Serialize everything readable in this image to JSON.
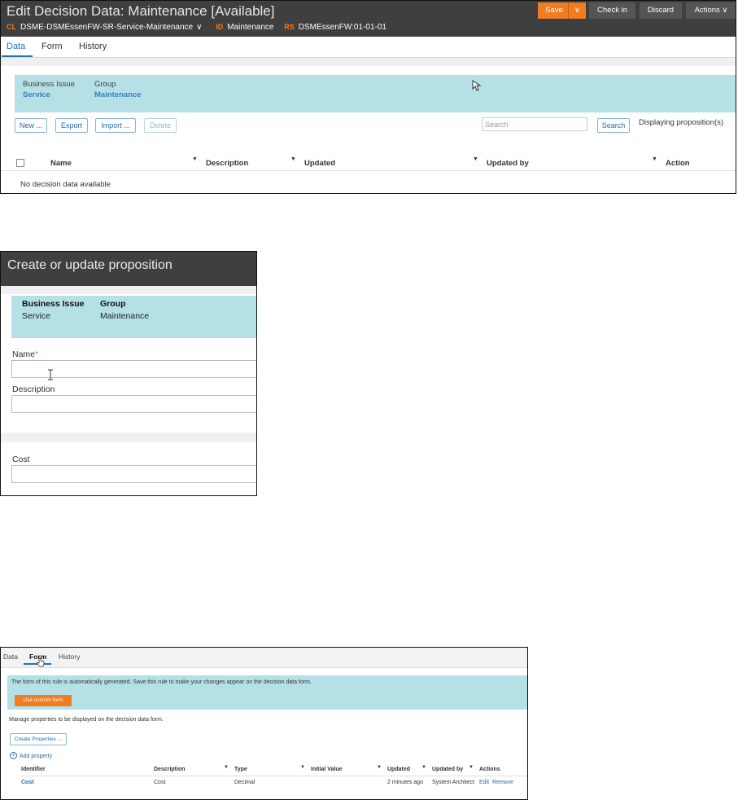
{
  "panel1": {
    "title": "Edit Decision Data: Maintenance [Available]",
    "meta": [
      {
        "key": "CL",
        "value": "DSME-DSMEssenFW-SR-Service-Maintenance"
      },
      {
        "key": "ID",
        "value": "Maintenance"
      },
      {
        "key": "RS",
        "value": "DSMEssenFW:01-01-01"
      }
    ],
    "chevron": "∨",
    "buttons": {
      "save": "Save",
      "check_in": "Check in",
      "discard": "Discard",
      "actions": "Actions ∨"
    },
    "tabs": [
      "Data",
      "Form",
      "History"
    ],
    "context": {
      "business_issue_label": "Business Issue",
      "business_issue": "Service",
      "group_label": "Group",
      "group": "Maintenance"
    },
    "toolbar": {
      "new": "New ...",
      "export": "Export",
      "import": "Import ...",
      "delete": "Delete"
    },
    "search": {
      "placeholder": "Search",
      "button": "Search"
    },
    "displaying": "Displaying proposition(s)",
    "columns": [
      "Name",
      "Description",
      "Updated",
      "Updated by",
      "Action"
    ],
    "empty": "No decision data available",
    "filter_glyph": "▼"
  },
  "panel2": {
    "title": "Create or update proposition",
    "context": {
      "business_issue_label": "Business Issue",
      "business_issue": "Service",
      "group_label": "Group",
      "group": "Maintenance"
    },
    "fields": {
      "name": "Name",
      "required": "*",
      "description": "Description",
      "cost": "Cost"
    }
  },
  "panel3": {
    "tabs": [
      "Data",
      "Form",
      "History"
    ],
    "note": "The form of this rule is automatically generated. Save this rule to make your changes appear on the decision data form.",
    "custom_form_button": "Use custom form",
    "manage_text": "Manage properties to be displayed on the decision data form.",
    "create_button": "Create Properties ...",
    "add_property": "Add property",
    "columns": [
      "Identifier",
      "Description",
      "Type",
      "Initial Value",
      "Updated",
      "Updated by",
      "Actions"
    ],
    "row": {
      "identifier": "Cost",
      "description": "Cost",
      "type": "Decimal",
      "updated": "2 minutes ago",
      "updated_by": "System Architect",
      "edit": "Edit",
      "remove": "Remove"
    },
    "plus": "+"
  },
  "colors": {
    "accent": "#f07d22",
    "teal": "#b4e0e6",
    "header": "#3f3f3f",
    "link": "#2a6aa5"
  }
}
